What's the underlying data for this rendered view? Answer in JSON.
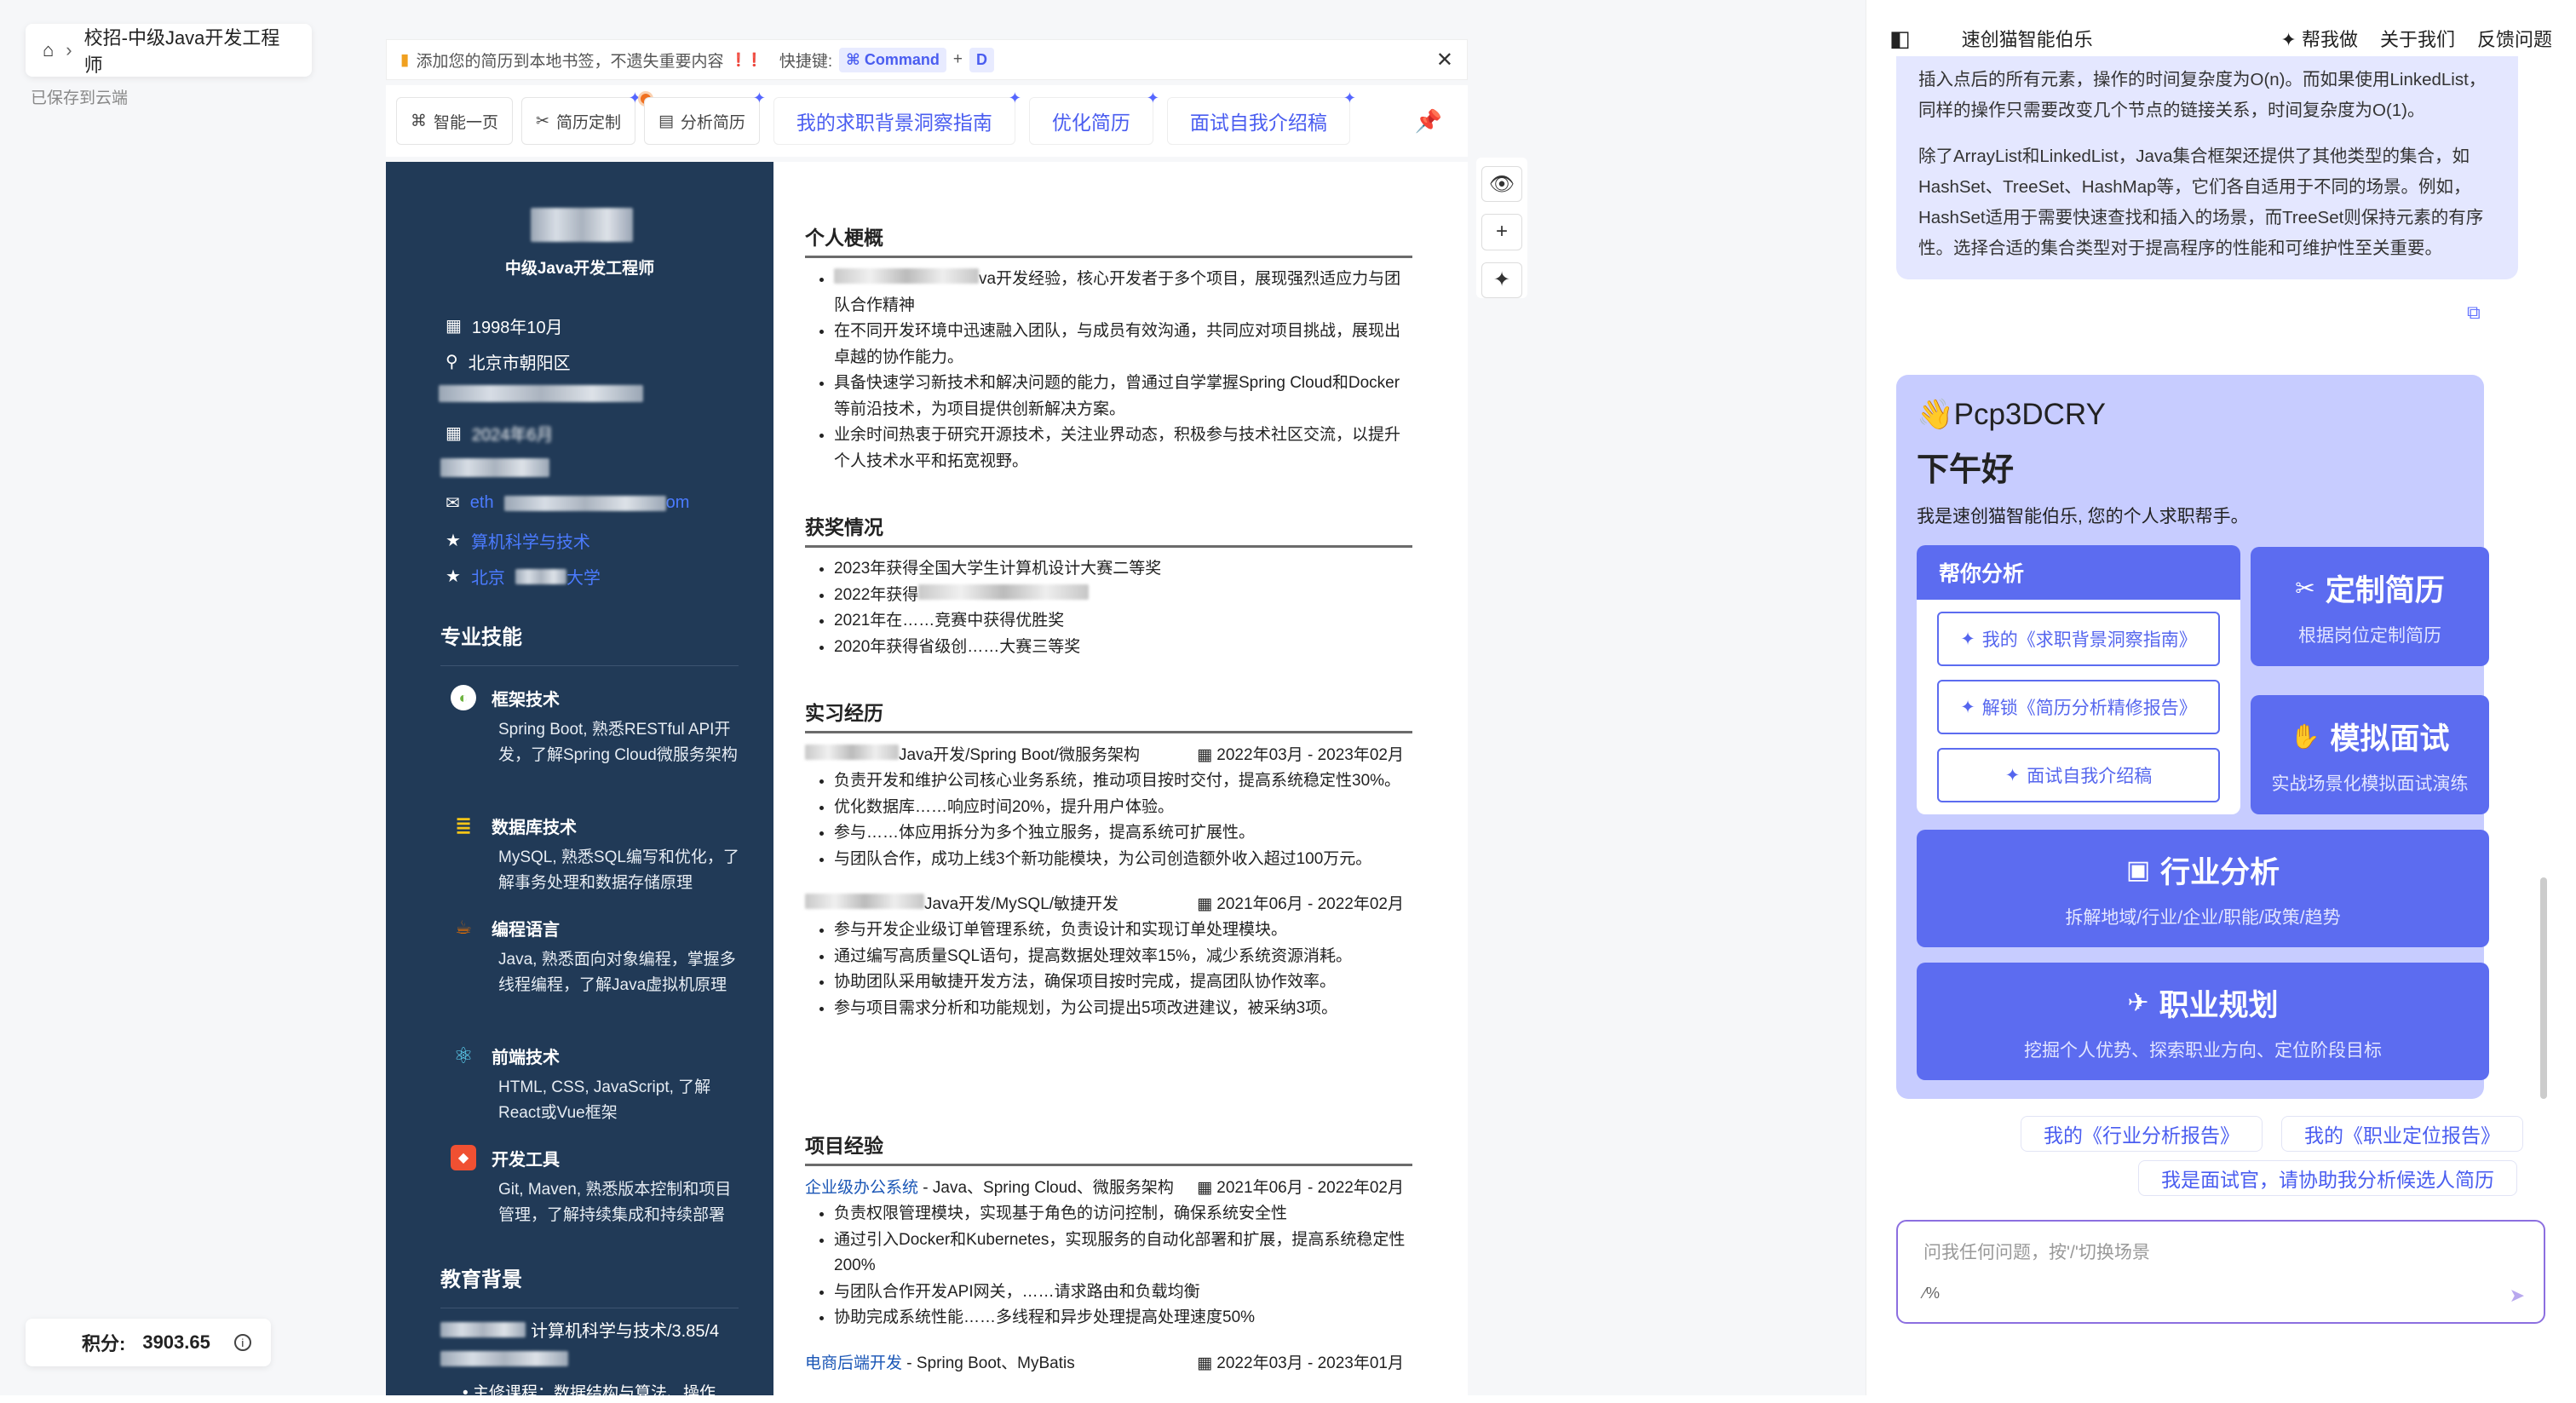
{
  "breadcrumb": {
    "home_icon": "home-icon",
    "sep": "›",
    "title": "校招-中级Java开发工程师"
  },
  "saved_status": "已保存到云端",
  "points": {
    "label": "积分:",
    "value": "3903.65"
  },
  "bookmark_bar": {
    "text": "添加您的简历到本地书签，不遗失重要内容",
    "excl": "❗❗",
    "shortcut_label": "快捷键:",
    "key1": "⌘ Command",
    "plus": "+",
    "key2": "D"
  },
  "toolbar": {
    "smart_page": "智能一页",
    "customize": "简历定制",
    "analyze": "分析简历",
    "links": [
      "我的求职背景洞察指南",
      "优化简历",
      "面试自我介绍稿"
    ]
  },
  "resume": {
    "name_title": "中级Java开发工程师",
    "birth": "1998年10月",
    "location": "北京市朝阳区",
    "year_partial": "2024年6月",
    "email_prefix": "eth",
    "email_suffix": "om",
    "major_partial": "算机科学与技术",
    "school_prefix": "北京",
    "school_suffix": "大学",
    "skills_heading": "专业技能",
    "skills": [
      {
        "title": "框架技术",
        "desc": "Spring Boot, 熟悉RESTful API开发，了解Spring Cloud微服务架构",
        "icon": "spring-icon",
        "color": "#6db33f"
      },
      {
        "title": "数据库技术",
        "desc": "MySQL, 熟悉SQL编写和优化，了解事务处理和数据存储原理",
        "icon": "database-icon",
        "color": "#f5c518"
      },
      {
        "title": "编程语言",
        "desc": "Java, 熟悉面向对象编程，掌握多线程编程，了解Java虚拟机原理",
        "icon": "java-icon",
        "color": "#e76f00"
      },
      {
        "title": "前端技术",
        "desc": "HTML, CSS, JavaScript, 了解React或Vue框架",
        "icon": "react-icon",
        "color": "#61dafb"
      },
      {
        "title": "开发工具",
        "desc": "Git, Maven, 熟悉版本控制和项目管理，了解持续集成和持续部署",
        "icon": "git-icon",
        "color": "#f05032"
      }
    ],
    "edu_heading": "教育背景",
    "edu_line": "计算机科学与技术/3.85/4",
    "edu_course": "主修课程：数据结构与算法、操作",
    "summary_heading": "个人梗概",
    "summary": [
      "va开发经验，核心开发者于多个项目，展现强烈适应力与团队合作精神",
      "在不同开发环境中迅速融入团队，与成员有效沟通，共同应对项目挑战，展现出卓越的协作能力。",
      "具备快速学习新技术和解决问题的能力，曾通过自学掌握Spring Cloud和Docker等前沿技术，为项目提供创新解决方案。",
      "业余时间热衷于研究开源技术，关注业界动态，积极参与技术社区交流，以提升个人技术水平和拓宽视野。"
    ],
    "awards_heading": "获奖情况",
    "awards": [
      "2023年获得全国大学生计算机设计大赛二等奖",
      "2022年获得",
      "2021年在……竞赛中获得优胜奖",
      "2020年获得省级创……大赛三等奖"
    ],
    "intern_heading": "实习经历",
    "jobs": [
      {
        "role": "Java开发/Spring Boot/微服务架构",
        "date": "2022年03月 - 2023年02月",
        "items": [
          "负责开发和维护公司核心业务系统，推动项目按时交付，提高系统稳定性30%。",
          "优化数据库……响应时间20%，提升用户体验。",
          "参与……体应用拆分为多个独立服务，提高系统可扩展性。",
          "与团队合作，成功上线3个新功能模块，为公司创造额外收入超过100万元。"
        ]
      },
      {
        "role": "Java开发/MySQL/敏捷开发",
        "date": "2021年06月 - 2022年02月",
        "items": [
          "参与开发企业级订单管理系统，负责设计和实现订单处理模块。",
          "通过编写高质量SQL语句，提高数据处理效率15%，减少系统资源消耗。",
          "协助团队采用敏捷开发方法，确保项目按时完成，提高团队协作效率。",
          "参与项目需求分析和功能规划，为公司提出5项改进建议，被采纳3项。"
        ]
      }
    ],
    "project_heading": "项目经验",
    "projects": [
      {
        "name": "企业级办公系统",
        "tech": " - Java、Spring Cloud、微服务架构",
        "date": "2021年06月 - 2022年02月",
        "items": [
          "负责权限管理模块，实现基于角色的访问控制，确保系统安全性",
          "通过引入Docker和Kubernetes，实现服务的自动化部署和扩展，提高系统稳定性200%",
          "与团队合作开发API网关，……请求路由和负载均衡",
          "协助完成系统性能……多线程和异步处理提高处理速度50%"
        ]
      },
      {
        "name": "电商后端开发",
        "tech": " - Spring Boot、MyBatis",
        "date": "2022年03月 - 2023年01月",
        "items": []
      }
    ]
  },
  "chat": {
    "brand": "速创猫智能伯乐",
    "nav": [
      "帮我做",
      "关于我们",
      "反馈问题"
    ],
    "bubble_p1": "插入点后的所有元素，操作的时间复杂度为O(n)。而如果使用LinkedList，同样的操作只需要改变几个节点的链接关系，时间复杂度为O(1)。",
    "bubble_p2": "除了ArrayList和LinkedList，Java集合框架还提供了其他类型的集合，如HashSet、TreeSet、HashMap等，它们各自适用于不同的场景。例如，HashSet适用于需要快速查找和插入的场景，而TreeSet则保持元素的有序性。选择合适的集合类型对于提高程序的性能和可维护性至关重要。",
    "wave": "👋",
    "username": "Pcp3DCRY",
    "greeting": "下午好",
    "intro": "我是速创猫智能伯乐, 您的个人求职帮手。",
    "help_heading": "帮你分析",
    "help_buttons": [
      "我的《求职背景洞察指南》",
      "解锁《简历分析精修报告》",
      "面试自我介绍稿"
    ],
    "cards": [
      {
        "title": "定制简历",
        "sub": "根据岗位定制简历"
      },
      {
        "title": "模拟面试",
        "sub": "实战场景化模拟面试演练"
      },
      {
        "title": "行业分析",
        "sub": "拆解地域/行业/企业/职能/政策/趋势"
      },
      {
        "title": "职业规划",
        "sub": "挖掘个人优势、探索职业方向、定位阶段目标"
      }
    ],
    "quick": [
      "我的《行业分析报告》",
      "我的《职业定位报告》",
      "我是面试官，请协助我分析候选人简历"
    ],
    "input_placeholder": "问我任何问题，按'/'切换场景",
    "input_hint": "⁄%"
  }
}
